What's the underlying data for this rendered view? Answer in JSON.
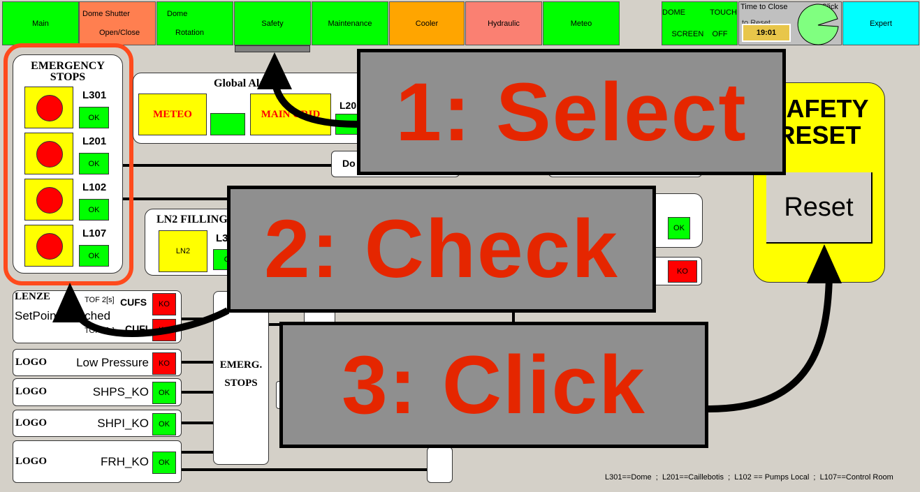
{
  "tabs": [
    {
      "l1": "Main",
      "color": "#00ff00"
    },
    {
      "l1": "Dome Shutter",
      "l2": "Open/Close",
      "color": "#ff7f50"
    },
    {
      "l1": "Dome",
      "l2": "Rotation",
      "color": "#00ff00"
    },
    {
      "l1": "Safety",
      "color": "#00ff00"
    },
    {
      "l1": "Maintenance",
      "color": "#00ff00"
    },
    {
      "l1": "Cooler",
      "color": "#ffa500"
    },
    {
      "l1": "Hydraulic",
      "color": "#fa8072"
    },
    {
      "l1": "Meteo",
      "color": "#00ff00"
    }
  ],
  "touch": {
    "l1a": "DOME",
    "l1b": "TOUCH",
    "l2a": "SCREEN",
    "l2b": "OFF"
  },
  "timer": {
    "label": "Time to Close",
    "label2": "to Reset",
    "click": "Click",
    "value": "19:01"
  },
  "expert": "Expert",
  "estops": {
    "title1": "EMERGENCY",
    "title2": "STOPS",
    "items": [
      {
        "label": "L301",
        "status": "OK"
      },
      {
        "label": "L201",
        "status": "OK"
      },
      {
        "label": "L102",
        "status": "OK"
      },
      {
        "label": "L107",
        "status": "OK"
      }
    ]
  },
  "global": {
    "title": "Global Alarms",
    "meteo": "METEO",
    "maingrid": "MAIN GRID",
    "l20": "L20"
  },
  "dome_box": "Do",
  "ln2": {
    "title": "LN2 FILLING",
    "button": "LN2",
    "l3": "L3",
    "status": "O"
  },
  "right": {
    "s1": "OK",
    "s2": "KO"
  },
  "reset": {
    "title1": "SAFETY",
    "title2": "RESET",
    "button": "Reset"
  },
  "lenze": {
    "title": "LENZE",
    "text": "SetPoint Reached",
    "tof1": "TOF 2[s]",
    "tof2": "TOF 2[s]",
    "cufs": "CUFS",
    "cufi": "CUFI",
    "s1": "KO",
    "s2": "KO"
  },
  "logos": [
    {
      "title": "LOGO",
      "label": "Low Pressure",
      "status": "KO"
    },
    {
      "title": "LOGO",
      "label": "SHPS_KO",
      "status": "OK"
    },
    {
      "title": "LOGO",
      "label": "SHPI_KO",
      "status": "OK"
    },
    {
      "title": "LOGO",
      "label": "FRH_KO",
      "status": "OK"
    }
  ],
  "emerg": {
    "l1": "EMERG.",
    "l2": "STOPS"
  },
  "legend": "L301==Dome  ;  L201==Caillebotis  ;  L102 == Pumps Local  ;  L107==Control Room",
  "overlays": {
    "o1": "1: Select",
    "o2": "2: Check",
    "o3": "3: Click"
  }
}
